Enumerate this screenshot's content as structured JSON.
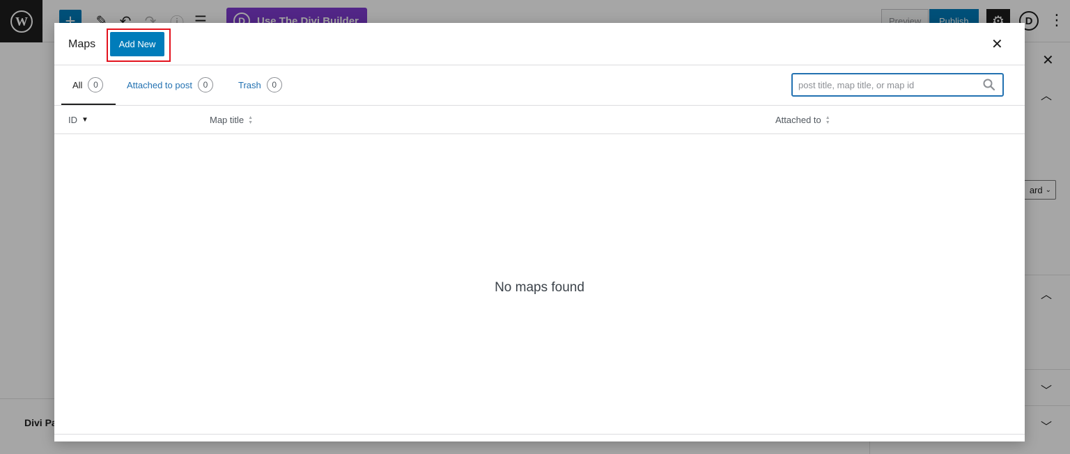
{
  "editor": {
    "divi_builder_label": "Use The Divi Builder",
    "preview_label": "Preview",
    "publish_label": "Publish",
    "divi_panel_label": "Divi Pa",
    "sidebar_select_value": "ard"
  },
  "modal": {
    "title": "Maps",
    "add_new_label": "Add New",
    "tabs": [
      {
        "label": "All",
        "count": "0"
      },
      {
        "label": "Attached to post",
        "count": "0"
      },
      {
        "label": "Trash",
        "count": "0"
      }
    ],
    "search": {
      "placeholder": "post title, map title, or map id",
      "value": ""
    },
    "columns": [
      {
        "label": "ID"
      },
      {
        "label": "Map title"
      },
      {
        "label": "Attached to"
      }
    ],
    "empty_message": "No maps found"
  },
  "colors": {
    "accent": "#007cba",
    "link": "#2271b1",
    "highlight": "#e3121d",
    "divi_purple": "#7e3bd0"
  }
}
